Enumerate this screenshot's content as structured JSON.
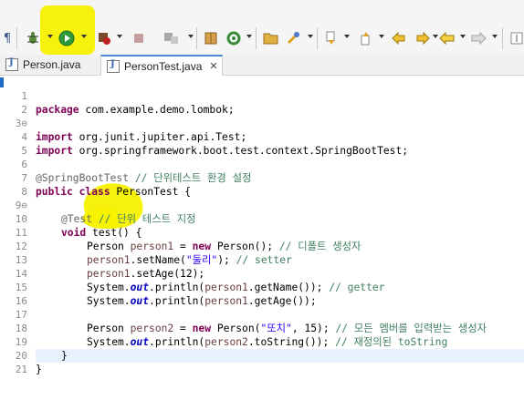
{
  "colors": {
    "highlight": "#f5f100",
    "keyword": "#7f0055",
    "comment": "#3f7f5f",
    "string": "#2a00ff",
    "field": "#0000c0",
    "annotation": "#646464"
  },
  "toolbar": {
    "icons": [
      "pilcrow-icon",
      "debug-icon",
      "run-icon",
      "run-server-icon",
      "stop-icon",
      "deploy-icon",
      "new-package-icon",
      "refresh-icon",
      "open-folder-icon",
      "wrench-icon",
      "next-annotation-icon",
      "prev-annotation-icon",
      "back-edit-icon",
      "forward-edit-icon",
      "back-icon",
      "forward-icon",
      "pin-icon"
    ]
  },
  "tabs": [
    {
      "label": "Person.java"
    },
    {
      "label": "PersonTest.java",
      "close": "✕"
    }
  ],
  "editor": {
    "lines": [
      {
        "num": "1"
      },
      {
        "num": "2"
      },
      {
        "num": "3⊖"
      },
      {
        "num": "4"
      },
      {
        "num": "5"
      },
      {
        "num": "6"
      },
      {
        "num": "7"
      },
      {
        "num": "8"
      },
      {
        "num": "9⊖"
      },
      {
        "num": "10"
      },
      {
        "num": "11"
      },
      {
        "num": "12"
      },
      {
        "num": "13"
      },
      {
        "num": "14"
      },
      {
        "num": "15"
      },
      {
        "num": "16"
      },
      {
        "num": "17"
      },
      {
        "num": "18"
      },
      {
        "num": "19"
      },
      {
        "num": "20"
      },
      {
        "num": "21"
      }
    ],
    "code": {
      "l1_kw": "package",
      "l1_rest": " com.example.demo.lombok;",
      "l3_kw": "import",
      "l3_rest": " org.junit.jupiter.api.Test;",
      "l4_kw": "import",
      "l4_rest": " org.springframework.boot.test.context.SpringBootTest;",
      "l6_an": "@SpringBootTest",
      "l6_cm": " // 단위테스트 환경 설정",
      "l7_kw": "public class",
      "l7_rest": " PersonTest {",
      "l9_an": "@Test",
      "l9_cm": " // 단위 테스트 지정",
      "l10_kw": "void",
      "l10_rest": " test() {",
      "l11_a": "Person ",
      "l11_var": "person1",
      "l11_b": " = ",
      "l11_kw": "new",
      "l11_c": " Person(); ",
      "l11_cm": "// 디폴트 생성자",
      "l12_var": "person1",
      "l12_a": ".setName(",
      "l12_st": "\"둘리\"",
      "l12_b": "); ",
      "l12_cm": "// setter",
      "l13_var": "person1",
      "l13_a": ".setAge(12);",
      "l14_a": "System.",
      "l14_fi": "out",
      "l14_b": ".println(",
      "l14_var": "person1",
      "l14_c": ".getName()); ",
      "l14_cm": "// getter",
      "l15_a": "System.",
      "l15_fi": "out",
      "l15_b": ".println(",
      "l15_var": "person1",
      "l15_c": ".getAge());",
      "l17_a": "Person ",
      "l17_var": "person2",
      "l17_b": " = ",
      "l17_kw": "new",
      "l17_c": " Person(",
      "l17_st": "\"또치\"",
      "l17_d": ", 15); ",
      "l17_cm": "// 모든 멤버를 입력받는 생성자",
      "l18_a": "System.",
      "l18_fi": "out",
      "l18_b": ".println(",
      "l18_var": "person2",
      "l18_c": ".toString()); ",
      "l18_cm": "// 재정의된 toString",
      "l19": "}",
      "l20": "}"
    }
  }
}
